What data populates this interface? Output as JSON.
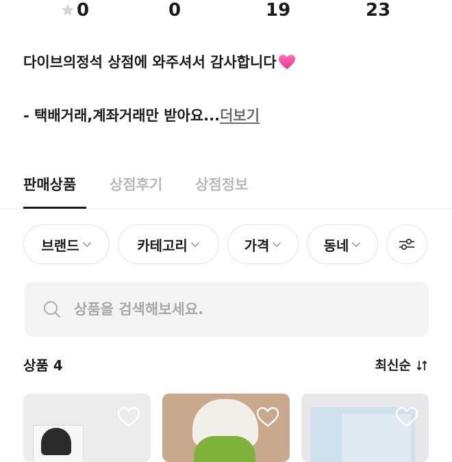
{
  "stats": {
    "rating": "0",
    "reviews": "0",
    "followers": "19",
    "following": "23"
  },
  "intro": {
    "greeting": "다이브의정석 상점에 와주셔서 감사합니다",
    "policy": "- 택배거래,계좌거래만 받아요...",
    "more_link": "더보기"
  },
  "tabs": [
    "판매상품",
    "상점후기",
    "상점정보"
  ],
  "filters": [
    "브랜드",
    "카테고리",
    "가격",
    "동네"
  ],
  "search": {
    "placeholder": "상품을 검색해보세요."
  },
  "list": {
    "count_label": "상품 4",
    "sort_label": "최신순"
  },
  "colors": {
    "accent_heart": "#e8348f",
    "text": "#1a1a1a",
    "muted": "#b8b8b8"
  },
  "icons": [
    "star-icon",
    "heart-emoji-icon",
    "chevron-down-icon",
    "filter-sliders-icon",
    "search-icon",
    "sort-arrows-icon",
    "favorite-heart-icon"
  ]
}
